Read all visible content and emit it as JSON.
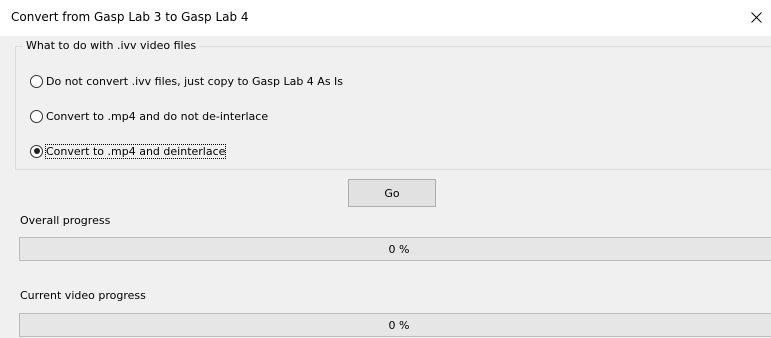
{
  "window": {
    "title": "Convert from Gasp Lab 3 to Gasp Lab 4",
    "close_icon": "close-icon"
  },
  "ivv_group": {
    "legend": "What to do with .ivv video files",
    "options": [
      {
        "label": "Do not convert .ivv files, just copy to Gasp Lab 4 As Is",
        "checked": false
      },
      {
        "label": "Convert to .mp4 and do not de-interlace",
        "checked": false
      },
      {
        "label": "Convert to .mp4 and deinterlace",
        "checked": true
      }
    ]
  },
  "go_button": {
    "label": "Go"
  },
  "overall_progress": {
    "label": "Overall progress",
    "value": 0,
    "text": "0 %"
  },
  "current_video_progress": {
    "label": "Current video progress",
    "value": 0,
    "text": "0 %"
  },
  "colors": {
    "dialog_background": "#f0f0f0",
    "titlebar_background": "#ffffff",
    "progress_track": "#e6e6e6",
    "progress_fill": "#06b025"
  }
}
